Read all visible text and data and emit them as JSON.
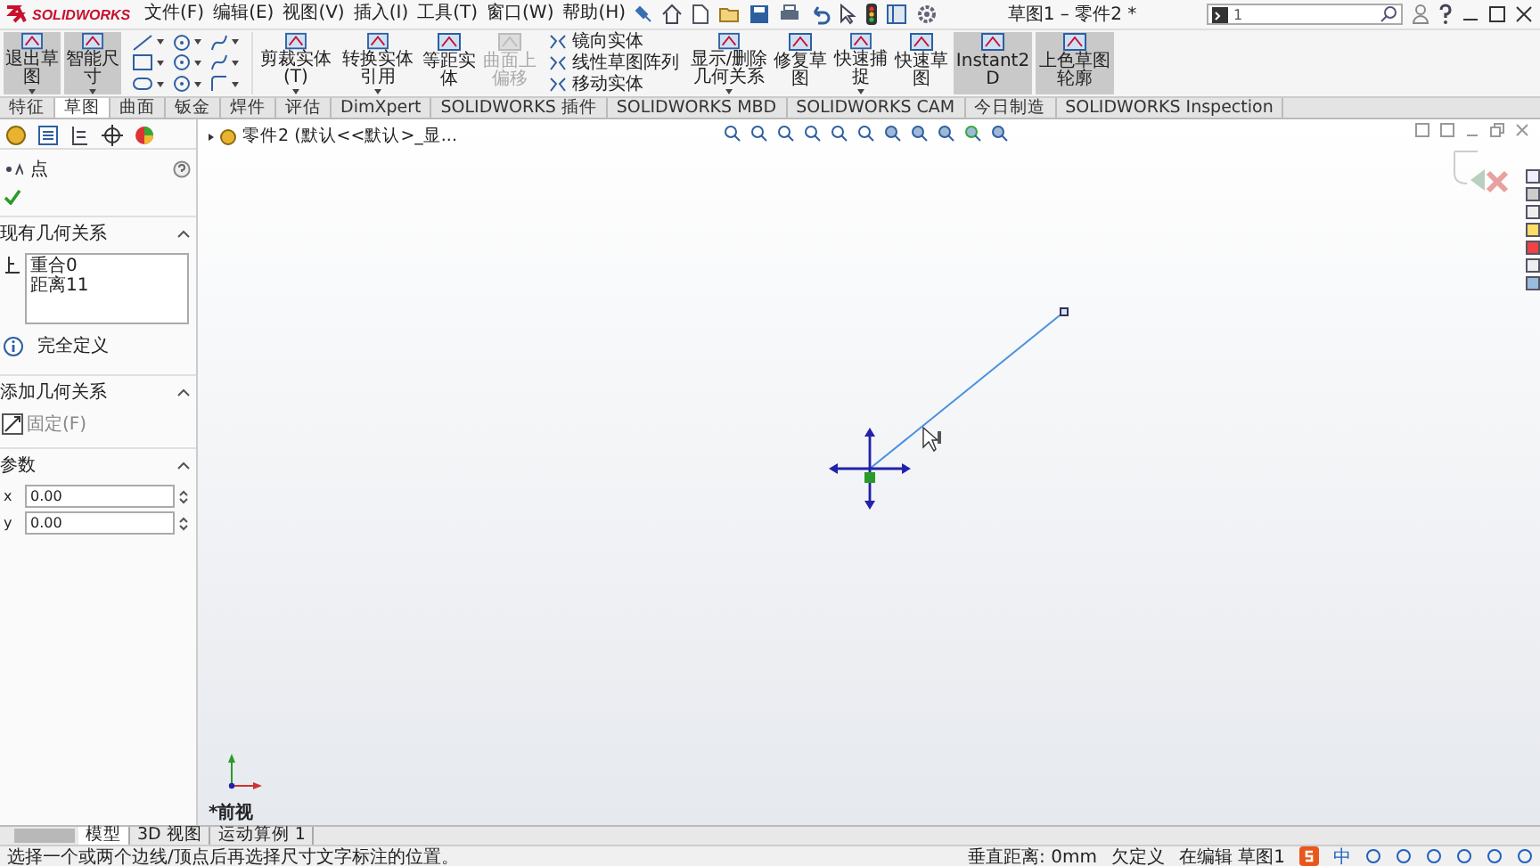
{
  "app": {
    "logo": "SOLIDWORKS",
    "menus": [
      "文件(F)",
      "编辑(E)",
      "视图(V)",
      "插入(I)",
      "工具(T)",
      "窗口(W)",
      "帮助(H)"
    ],
    "title": "草图1 – 零件2 *",
    "search": {
      "value": "1"
    }
  },
  "ribbon": [
    {
      "kind": "big",
      "label": "退出草图",
      "selected": true,
      "disabled": false,
      "dropdown": true
    },
    {
      "kind": "big",
      "label": "智能尺寸",
      "selected": true,
      "disabled": false,
      "dropdown": true
    },
    {
      "kind": "tools"
    },
    {
      "kind": "big",
      "label": "剪裁实体(T)",
      "selected": false,
      "disabled": false,
      "dropdown": true
    },
    {
      "kind": "big",
      "label": "转换实体引用",
      "selected": false,
      "disabled": false,
      "dropdown": true
    },
    {
      "kind": "big",
      "label": "等距实体",
      "selected": false,
      "disabled": false,
      "dropdown": false
    },
    {
      "kind": "big",
      "label": "曲面上偏移",
      "selected": false,
      "disabled": true,
      "dropdown": false
    },
    {
      "kind": "stack",
      "items": [
        "镜向实体",
        "线性草图阵列",
        "移动实体"
      ]
    },
    {
      "kind": "big",
      "label": "显示/删除几何关系",
      "selected": false,
      "disabled": false,
      "dropdown": true
    },
    {
      "kind": "big",
      "label": "修复草图",
      "selected": false,
      "disabled": false,
      "dropdown": false
    },
    {
      "kind": "big",
      "label": "快速捕捉",
      "selected": false,
      "disabled": false,
      "dropdown": true
    },
    {
      "kind": "big",
      "label": "快速草图",
      "selected": false,
      "disabled": false,
      "dropdown": false
    },
    {
      "kind": "big",
      "label": "Instant2D",
      "selected": true,
      "disabled": false,
      "dropdown": false
    },
    {
      "kind": "big",
      "label": "上色草图轮廓",
      "selected": true,
      "disabled": false,
      "dropdown": false
    }
  ],
  "tabs": [
    {
      "label": "特征",
      "selected": false
    },
    {
      "label": "草图",
      "selected": true
    },
    {
      "label": "曲面",
      "selected": false
    },
    {
      "label": "钣金",
      "selected": false
    },
    {
      "label": "焊件",
      "selected": false
    },
    {
      "label": "评估",
      "selected": false
    },
    {
      "label": "DimXpert",
      "selected": false
    },
    {
      "label": "SOLIDWORKS 插件",
      "selected": false
    },
    {
      "label": "SOLIDWORKS MBD",
      "selected": false
    },
    {
      "label": "SOLIDWORKS CAM",
      "selected": false
    },
    {
      "label": "今日制造",
      "selected": false
    },
    {
      "label": "SOLIDWORKS Inspection",
      "selected": false
    }
  ],
  "panel": {
    "title": "点",
    "existing": {
      "heading": "现有几何关系",
      "relations": [
        "重合0",
        "距离11"
      ]
    },
    "status": "完全定义",
    "add": {
      "heading": "添加几何关系",
      "options": [
        "固定(F)"
      ]
    },
    "params": {
      "heading": "参数",
      "fields": [
        {
          "axis": "x",
          "value": "0.00"
        },
        {
          "axis": "y",
          "value": "0.00"
        }
      ]
    }
  },
  "canvas": {
    "breadcrumb": "零件2 (默认<<默认>_显...",
    "view_label": "*前视"
  },
  "bottom_tabs": [
    {
      "label": "模型",
      "selected": true
    },
    {
      "label": "3D 视图",
      "selected": false
    },
    {
      "label": "运动算例 1",
      "selected": false
    }
  ],
  "status_bar": {
    "message": "选择一个或两个边线/顶点后再选择尺寸文字标注的位置。",
    "fields": [
      "垂直距离: 0mm",
      "欠定义",
      "在编辑 草图1"
    ],
    "ime": "中"
  }
}
